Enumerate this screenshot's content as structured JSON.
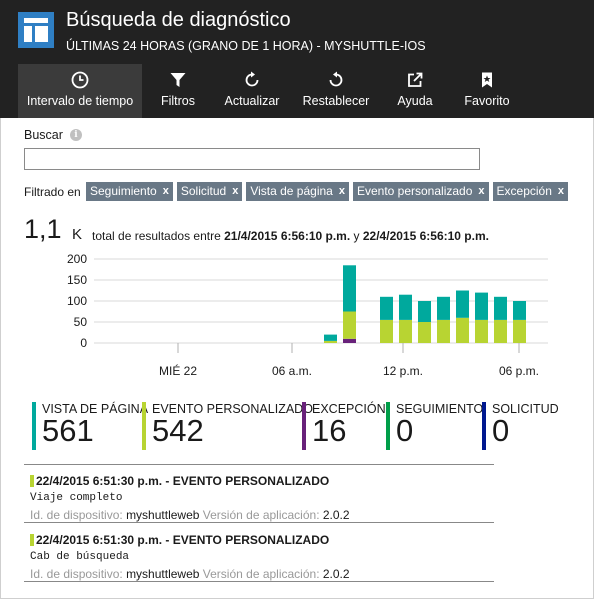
{
  "header": {
    "title": "Búsqueda de diagnóstico",
    "subtitle": "ÚLTIMAS 24 HORAS (GRANO DE 1 HORA) - MYSHUTTLE-IOS",
    "brand_color": "#2f7fc4",
    "background": "#222222"
  },
  "toolbar": {
    "items": [
      {
        "label": "Intervalo de tiempo",
        "icon": "clock-icon",
        "active": true
      },
      {
        "label": "Filtros",
        "icon": "funnel-icon",
        "active": false
      },
      {
        "label": "Actualizar",
        "icon": "refresh-icon",
        "active": false
      },
      {
        "label": "Restablecer",
        "icon": "undo-icon",
        "active": false
      },
      {
        "label": "Ayuda",
        "icon": "external-link-icon",
        "active": false
      },
      {
        "label": "Favorito",
        "icon": "bookmark-star-icon",
        "active": false
      }
    ]
  },
  "search": {
    "label": "Buscar",
    "info_icon": "i",
    "value": ""
  },
  "filters": {
    "label": "Filtrado en",
    "chips": [
      "Seguimiento",
      "Solicitud",
      "Vista de página",
      "Evento personalizado",
      "Excepción"
    ],
    "remove_glyph": "x"
  },
  "total": {
    "value": "1,1",
    "unit": "K",
    "prefix": "total de resultados entre",
    "start": "21/4/2015 6:56:10 p.m.",
    "conjunction": "y",
    "end": "22/4/2015 6:56:10 p.m."
  },
  "chart_data": {
    "type": "bar",
    "stacked": true,
    "yticks": [
      "200",
      "150",
      "100",
      "50",
      "0"
    ],
    "ylim": [
      0,
      200
    ],
    "xticks": [
      "MIÉ 22",
      "06 a.m.",
      "12 p.m.",
      "06 p.m."
    ],
    "grid": true,
    "colors": {
      "excepcion": "#68217a",
      "evento_personalizado": "#b8d432",
      "vista_de_pagina": "#00a99d"
    },
    "bars": [
      {
        "excepcion": 0,
        "evento_personalizado": 5,
        "vista_de_pagina": 15
      },
      {
        "excepcion": 10,
        "evento_personalizado": 65,
        "vista_de_pagina": 110
      },
      {
        "excepcion": 0,
        "evento_personalizado": 55,
        "vista_de_pagina": 55
      },
      {
        "excepcion": 0,
        "evento_personalizado": 55,
        "vista_de_pagina": 60
      },
      {
        "excepcion": 0,
        "evento_personalizado": 50,
        "vista_de_pagina": 50
      },
      {
        "excepcion": 0,
        "evento_personalizado": 55,
        "vista_de_pagina": 55
      },
      {
        "excepcion": 0,
        "evento_personalizado": 60,
        "vista_de_pagina": 65
      },
      {
        "excepcion": 0,
        "evento_personalizado": 55,
        "vista_de_pagina": 65
      },
      {
        "excepcion": 0,
        "evento_personalizado": 55,
        "vista_de_pagina": 55
      },
      {
        "excepcion": 0,
        "evento_personalizado": 55,
        "vista_de_pagina": 45
      }
    ]
  },
  "summary": [
    {
      "label": "VISTA DE PÁGINA",
      "value": "561",
      "color": "#00a99d"
    },
    {
      "label": "EVENTO PERSONALIZADO",
      "value": "542",
      "color": "#b8d432"
    },
    {
      "label": "EXCEPCIÓN",
      "value": "16",
      "color": "#68217a"
    },
    {
      "label": "SEGUIMIENTO",
      "value": "0",
      "color": "#009e49"
    },
    {
      "label": "SOLICITUD",
      "value": "0",
      "color": "#00188f"
    }
  ],
  "events": [
    {
      "title": "22/4/2015 6:51:30 p.m. - EVENTO PERSONALIZADO",
      "detail": "Viaje completo",
      "device_key": "Id. de dispositivo:",
      "device_val": "myshuttleweb",
      "version_key": "Versión de aplicación:",
      "version_val": "2.0.2"
    },
    {
      "title": "22/4/2015 6:51:30 p.m. - EVENTO PERSONALIZADO",
      "detail": "Cab de búsqueda",
      "device_key": "Id. de dispositivo:",
      "device_val": "myshuttleweb",
      "version_key": "Versión de aplicación:",
      "version_val": "2.0.2"
    }
  ]
}
